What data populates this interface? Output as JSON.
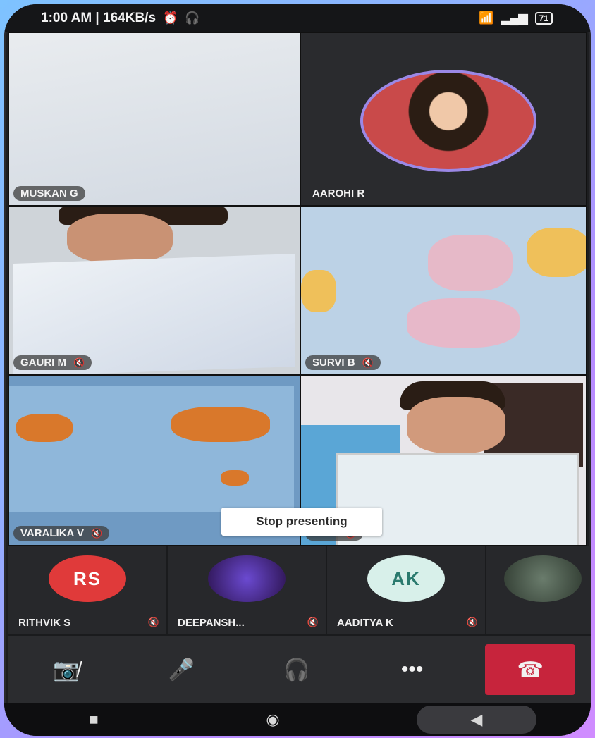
{
  "status_bar": {
    "time_speed": "1:00 AM | 164KB/s",
    "battery": "71"
  },
  "tiles": [
    {
      "name": "MUSKAN G",
      "muted": false
    },
    {
      "name": "AAROHI R",
      "muted": false
    },
    {
      "name": "GAURI M",
      "muted": true
    },
    {
      "name": "SURVI B",
      "muted": true
    },
    {
      "name": "VARALIKA V",
      "muted": true
    },
    {
      "name": "KA K",
      "muted": true
    }
  ],
  "toast": {
    "stop_presenting": "Stop presenting"
  },
  "participants": [
    {
      "initials": "RS",
      "name": "RITHVIK S",
      "color": "#e03a3a",
      "text_color": "#ffffff"
    },
    {
      "initials": "",
      "name": "DEEPANSH...",
      "color": "#4b2a8a",
      "text_color": "#ffffff"
    },
    {
      "initials": "AK",
      "name": "AADITYA K",
      "color": "#d8f0ea",
      "text_color": "#2a7a6e"
    },
    {
      "initials": "",
      "name": "",
      "color": "#4a5a4a",
      "text_color": "#ffffff"
    }
  ],
  "controls": {
    "camera": "camera-off-icon",
    "mic": "microphone-icon",
    "audio": "headset-icon",
    "more": "more-icon",
    "end": "end-call-icon"
  },
  "colors": {
    "end_call": "#c7243c",
    "avatar_ring": "#9b88e6"
  }
}
